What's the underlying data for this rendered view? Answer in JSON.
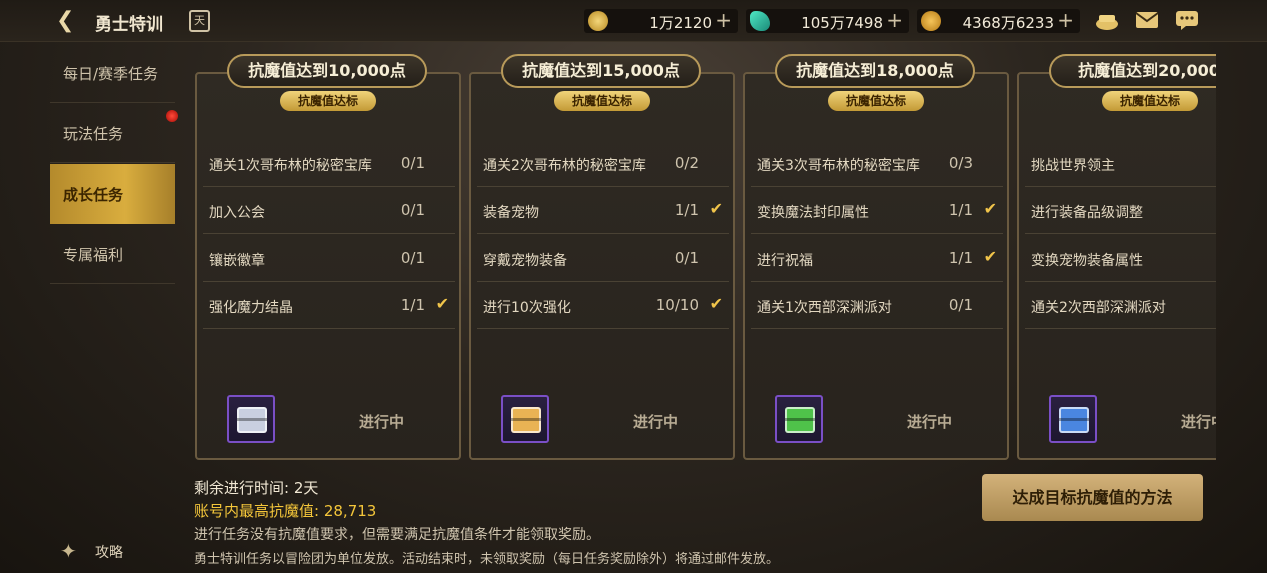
{
  "header": {
    "title": "勇士特训",
    "calendar_glyph": "天",
    "currencies": [
      {
        "icon": "gold-coin-icon",
        "value": "1万2120",
        "color": "#d8b44a"
      },
      {
        "icon": "crystal-icon",
        "value": "105万7498",
        "color": "#2fc6a8"
      },
      {
        "icon": "medal-coin-icon",
        "value": "4368万6233",
        "color": "#e0a52a"
      }
    ]
  },
  "sidebar": {
    "items": [
      {
        "label": "每日/赛季任务"
      },
      {
        "label": "玩法任务"
      },
      {
        "label": "成长任务"
      },
      {
        "label": "专属福利"
      }
    ]
  },
  "cards": [
    {
      "title": "抗魔值达到10,000点",
      "tag": "抗魔值达标",
      "status": "进行中",
      "chest_color": "#c9cfe0",
      "tasks": [
        {
          "name": "通关1次哥布林的秘密宝库",
          "progress": "0/1",
          "done": false
        },
        {
          "name": "加入公会",
          "progress": "0/1",
          "done": false
        },
        {
          "name": "镶嵌徽章",
          "progress": "0/1",
          "done": false
        },
        {
          "name": "强化魔力结晶",
          "progress": "1/1",
          "done": true
        }
      ]
    },
    {
      "title": "抗魔值达到15,000点",
      "tag": "抗魔值达标",
      "status": "进行中",
      "chest_color": "#e9b354",
      "tasks": [
        {
          "name": "通关2次哥布林的秘密宝库",
          "progress": "0/2",
          "done": false
        },
        {
          "name": "装备宠物",
          "progress": "1/1",
          "done": true
        },
        {
          "name": "穿戴宠物装备",
          "progress": "0/1",
          "done": false
        },
        {
          "name": "进行10次强化",
          "progress": "10/10",
          "done": true
        }
      ]
    },
    {
      "title": "抗魔值达到18,000点",
      "tag": "抗魔值达标",
      "status": "进行中",
      "chest_color": "#4fc24a",
      "tasks": [
        {
          "name": "通关3次哥布林的秘密宝库",
          "progress": "0/3",
          "done": false
        },
        {
          "name": "变换魔法封印属性",
          "progress": "1/1",
          "done": true
        },
        {
          "name": "进行祝福",
          "progress": "1/1",
          "done": true
        },
        {
          "name": "通关1次西部深渊派对",
          "progress": "0/1",
          "done": false
        }
      ]
    },
    {
      "title": "抗魔值达到20,000",
      "tag": "抗魔值达标",
      "status": "进行中",
      "chest_color": "#4a86e0",
      "tasks": [
        {
          "name": "挑战世界领主",
          "progress": "",
          "done": false
        },
        {
          "name": "进行装备品级调整",
          "progress": "",
          "done": false
        },
        {
          "name": "变换宠物装备属性",
          "progress": "",
          "done": false
        },
        {
          "name": "通关2次西部深渊派对",
          "progress": "",
          "done": false
        }
      ]
    }
  ],
  "footer": {
    "remaining_label": "剩余进行时间:",
    "remaining_value": "2天",
    "max_label": "账号内最高抗魔值:",
    "max_value": "28,713",
    "note1": "进行任务没有抗魔值要求，但需要满足抗魔值条件才能领取奖励。",
    "note2": "勇士特训任务以冒险团为单位发放。活动结束时，未领取奖励（每日任务奖励除外）将通过邮件发放。",
    "method_button": "达成目标抗魔值的方法",
    "guide_label": "攻略"
  }
}
